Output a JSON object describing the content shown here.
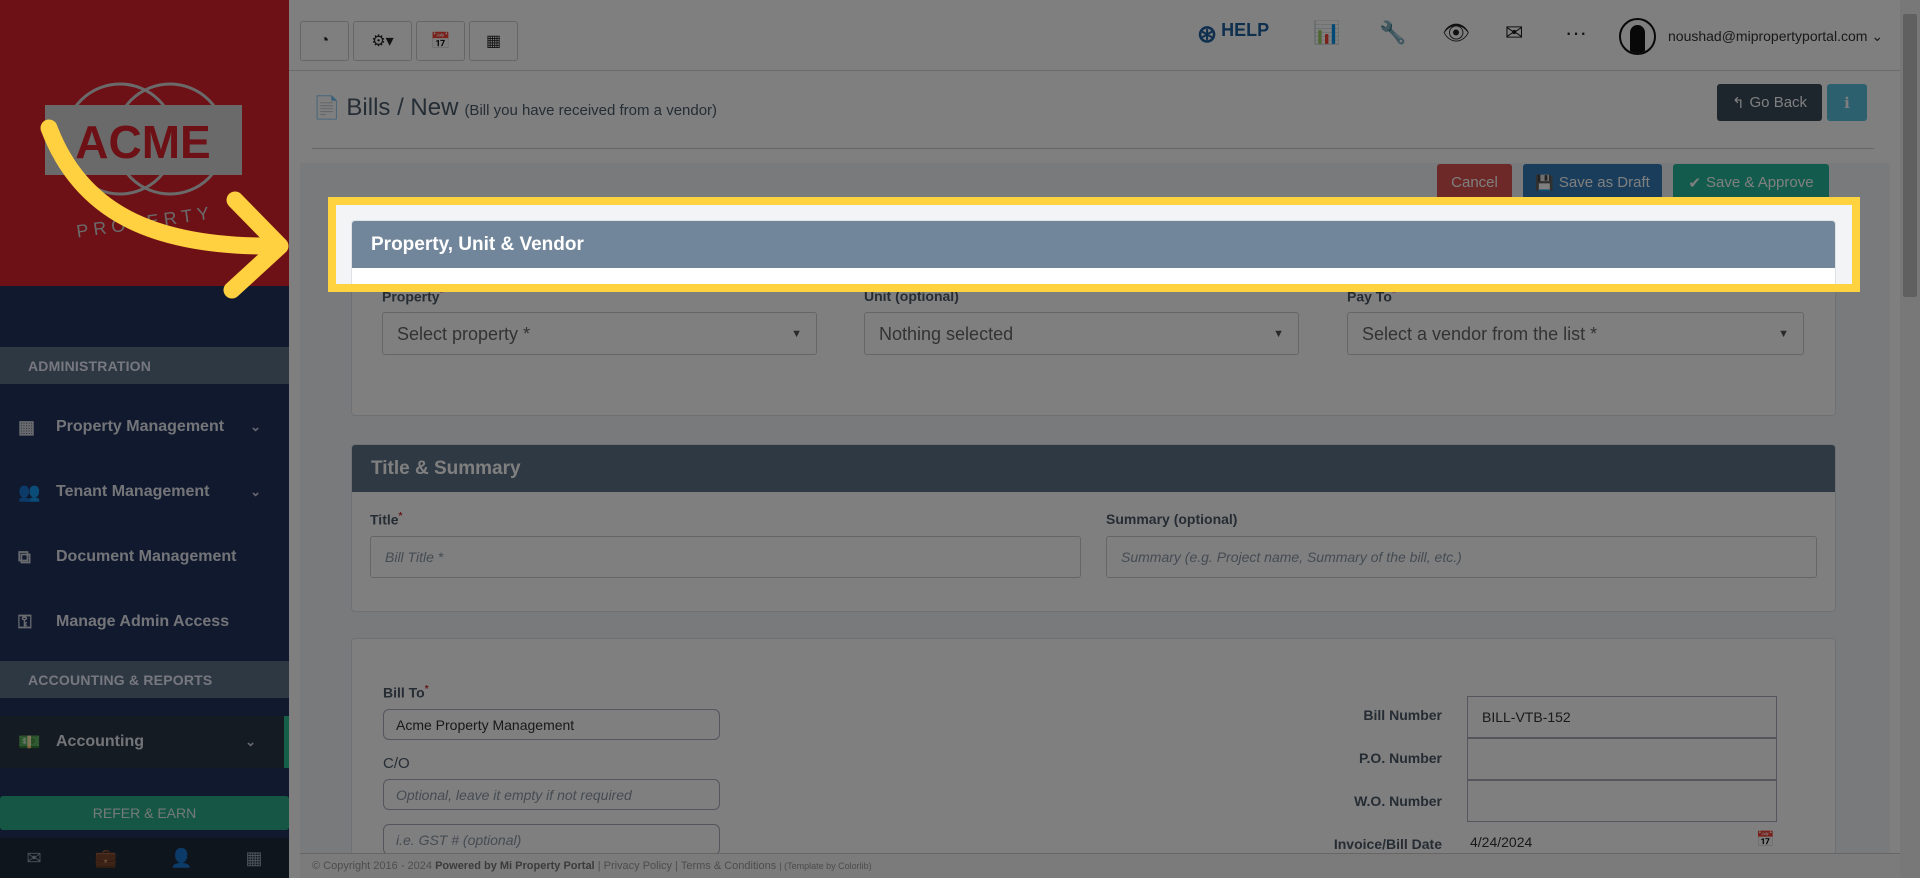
{
  "logo": {
    "brand": "ACME",
    "sub": "PROPERTY"
  },
  "sidebar": {
    "sections": [
      "ADMINISTRATION",
      "ACCOUNTING & REPORTS"
    ],
    "items": [
      {
        "label": "Property Management",
        "icon": "building-icon"
      },
      {
        "label": "Tenant Management",
        "icon": "users-icon"
      },
      {
        "label": "Document Management",
        "icon": "documents-icon"
      },
      {
        "label": "Manage Admin Access",
        "icon": "key-icon"
      },
      {
        "label": "Accounting",
        "icon": "money-icon"
      }
    ],
    "refer": "REFER & EARN"
  },
  "topbar": {
    "help": "HELP",
    "user_email": "noushad@mipropertyportal.com"
  },
  "page": {
    "title": "Bills / New",
    "subtitle": "(Bill you have received from a vendor)",
    "go_back": "Go Back"
  },
  "actions": {
    "cancel": "Cancel",
    "save_draft": "Save as Draft",
    "save_approve": "Save & Approve"
  },
  "card1": {
    "title": "Property, Unit & Vendor",
    "property_label": "Property",
    "property_value": "Select property *",
    "unit_label": "Unit (optional)",
    "unit_value": "Nothing selected",
    "payto_label": "Pay To",
    "payto_value": "Select a vendor from the list *"
  },
  "card2": {
    "title": "Title & Summary",
    "title_label": "Title",
    "title_placeholder": "Bill Title *",
    "summary_label": "Summary (optional)",
    "summary_placeholder": "Summary (e.g. Project name, Summary of the bill, etc.)"
  },
  "card3": {
    "bill_to_label": "Bill To",
    "bill_to_value": "Acme Property Management",
    "co_label": "C/O",
    "co_placeholder": "Optional, leave it empty if not required",
    "gst_placeholder": "i.e. GST # (optional)",
    "bill_number_label": "Bill Number",
    "bill_number_value": "BILL-VTB-152",
    "po_label": "P.O. Number",
    "wo_label": "W.O. Number",
    "date_label": "Invoice/Bill Date",
    "date_value": "4/24/2024"
  },
  "footer": {
    "copyright": "© Copyright 2016 - 2024",
    "powered": "Powered by Mi Property Portal",
    "privacy": "| Privacy Policy",
    "terms": "| Terms & Conditions",
    "template": "| (Template by Colorlib)"
  },
  "colors": {
    "highlight": "#ffd240",
    "brand_red": "#dc222c",
    "header": "#71869a"
  }
}
